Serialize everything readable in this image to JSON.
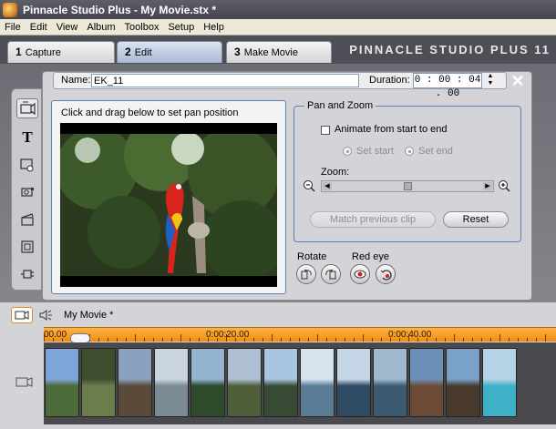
{
  "window": {
    "title": "Pinnacle Studio Plus - My Movie.stx *"
  },
  "menu": [
    "File",
    "Edit",
    "View",
    "Album",
    "Toolbox",
    "Setup",
    "Help"
  ],
  "tabs": [
    {
      "num": "1",
      "label": "Capture"
    },
    {
      "num": "2",
      "label": "Edit"
    },
    {
      "num": "3",
      "label": "Make Movie"
    }
  ],
  "active_tab": "Edit",
  "brand": "PINNACLE STUDIO PLUS 11",
  "clip_props": {
    "name_label": "Name:",
    "name_value": "EK_11",
    "duration_label": "Duration:",
    "duration_value": "0 : 00 : 04 . 00"
  },
  "preview": {
    "caption": "Click and drag below to set pan position"
  },
  "pan_zoom": {
    "title": "Pan and Zoom",
    "animate_label": "Animate from start to end",
    "animate_checked": false,
    "set_start_label": "Set start",
    "set_end_label": "Set end",
    "zoom_label": "Zoom:",
    "match_button": "Match previous clip",
    "reset_button": "Reset"
  },
  "rotate": {
    "label": "Rotate"
  },
  "red_eye": {
    "label": "Red eye"
  },
  "timeline": {
    "movie_title": "My Movie *",
    "ruler_labels": [
      "00.00",
      "0:00:20.00",
      "0:00:40.00"
    ],
    "clip_count": 13
  },
  "colors": {
    "accent_blue": "#5d7fb1",
    "ruler_orange": "#f49a1f",
    "red_eye": "#d21c1c"
  }
}
